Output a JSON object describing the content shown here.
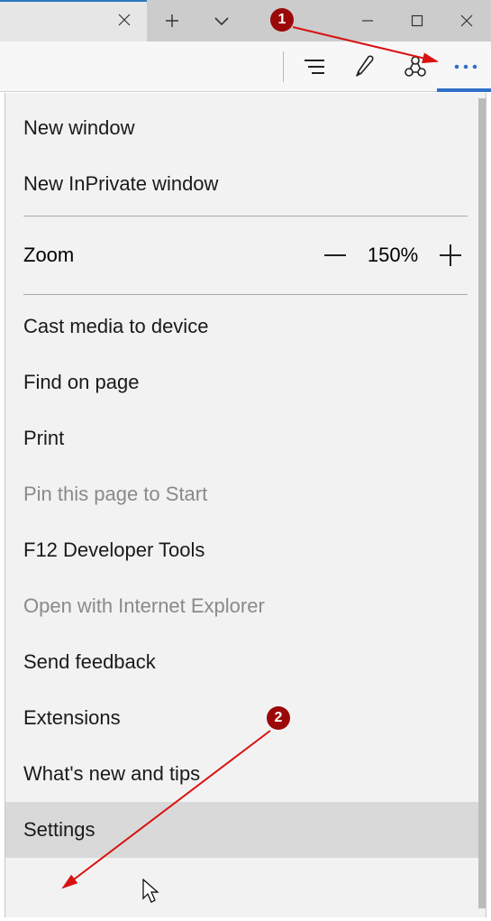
{
  "zoom": {
    "label": "Zoom",
    "value": "150%"
  },
  "menu": {
    "new_window": "New window",
    "new_inprivate": "New InPrivate window",
    "cast": "Cast media to device",
    "find": "Find on page",
    "print": "Print",
    "pin": "Pin this page to Start",
    "devtools": "F12 Developer Tools",
    "open_ie": "Open with Internet Explorer",
    "feedback": "Send feedback",
    "extensions": "Extensions",
    "whatsnew": "What's new and tips",
    "settings": "Settings"
  },
  "annotations": {
    "step1": "1",
    "step2": "2"
  }
}
